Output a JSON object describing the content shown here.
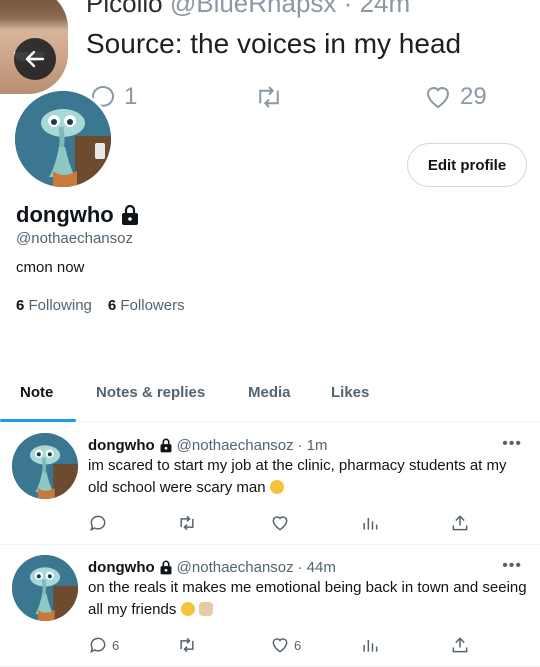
{
  "banner": {
    "name": "Picollo",
    "handle": "@BlueRhapsx",
    "time": "24m",
    "text": "Source: the voices in my head",
    "reply_count": "1",
    "like_count": "29"
  },
  "profile": {
    "display_name": "dongwho",
    "handle": "@nothaechansoz",
    "bio": "cmon now",
    "following_count": "6",
    "following_label": "Following",
    "followers_count": "6",
    "followers_label": "Followers",
    "edit_label": "Edit profile"
  },
  "tabs": [
    {
      "label": "Note",
      "active": true
    },
    {
      "label": "Notes & replies",
      "active": false
    },
    {
      "label": "Media",
      "active": false
    },
    {
      "label": "Likes",
      "active": false
    }
  ],
  "tweets": [
    {
      "name": "dongwho",
      "handle": "@nothaechansoz",
      "sep": "·",
      "time": "1m",
      "text": "im scared to start my job at the clinic, pharmacy students at my old school were scary man",
      "emoji": "tired-face",
      "reply_count": "",
      "like_count": ""
    },
    {
      "name": "dongwho",
      "handle": "@nothaechansoz",
      "sep": "·",
      "time": "44m",
      "text": "on the reals it makes me emotional being back in town and seeing all my friends",
      "emoji": "laughing-victory",
      "reply_count": "6",
      "like_count": "6"
    }
  ],
  "colors": {
    "accent": "#1d9bf0",
    "muted": "#536471",
    "text": "#0f1419"
  }
}
